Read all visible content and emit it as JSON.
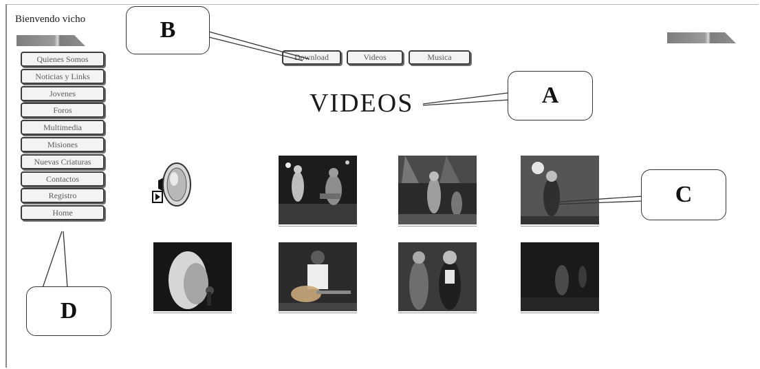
{
  "header": {
    "welcome": "Bienvendo vicho"
  },
  "sidebar": {
    "items": [
      {
        "label": "Quienes Somos"
      },
      {
        "label": "Noticias y Links"
      },
      {
        "label": "Jovenes"
      },
      {
        "label": "Foros"
      },
      {
        "label": "Multimedia"
      },
      {
        "label": "Misiones"
      },
      {
        "label": "Nuevas Criaturas"
      },
      {
        "label": "Contactos"
      },
      {
        "label": "Registro"
      },
      {
        "label": "Home"
      }
    ]
  },
  "top_menu": {
    "items": [
      {
        "label": "Download"
      },
      {
        "label": "Videos"
      },
      {
        "label": "Musica"
      }
    ]
  },
  "main": {
    "title": "VIDEOS"
  },
  "callouts": {
    "a": "A",
    "b": "B",
    "c": "C",
    "d": "D"
  },
  "icons": {
    "audio": "speaker-icon",
    "play": "play-icon"
  },
  "colors": {
    "button_border": "#3c3c3c",
    "button_text": "#5a5a5a",
    "stripe": "#8a8a8a"
  }
}
